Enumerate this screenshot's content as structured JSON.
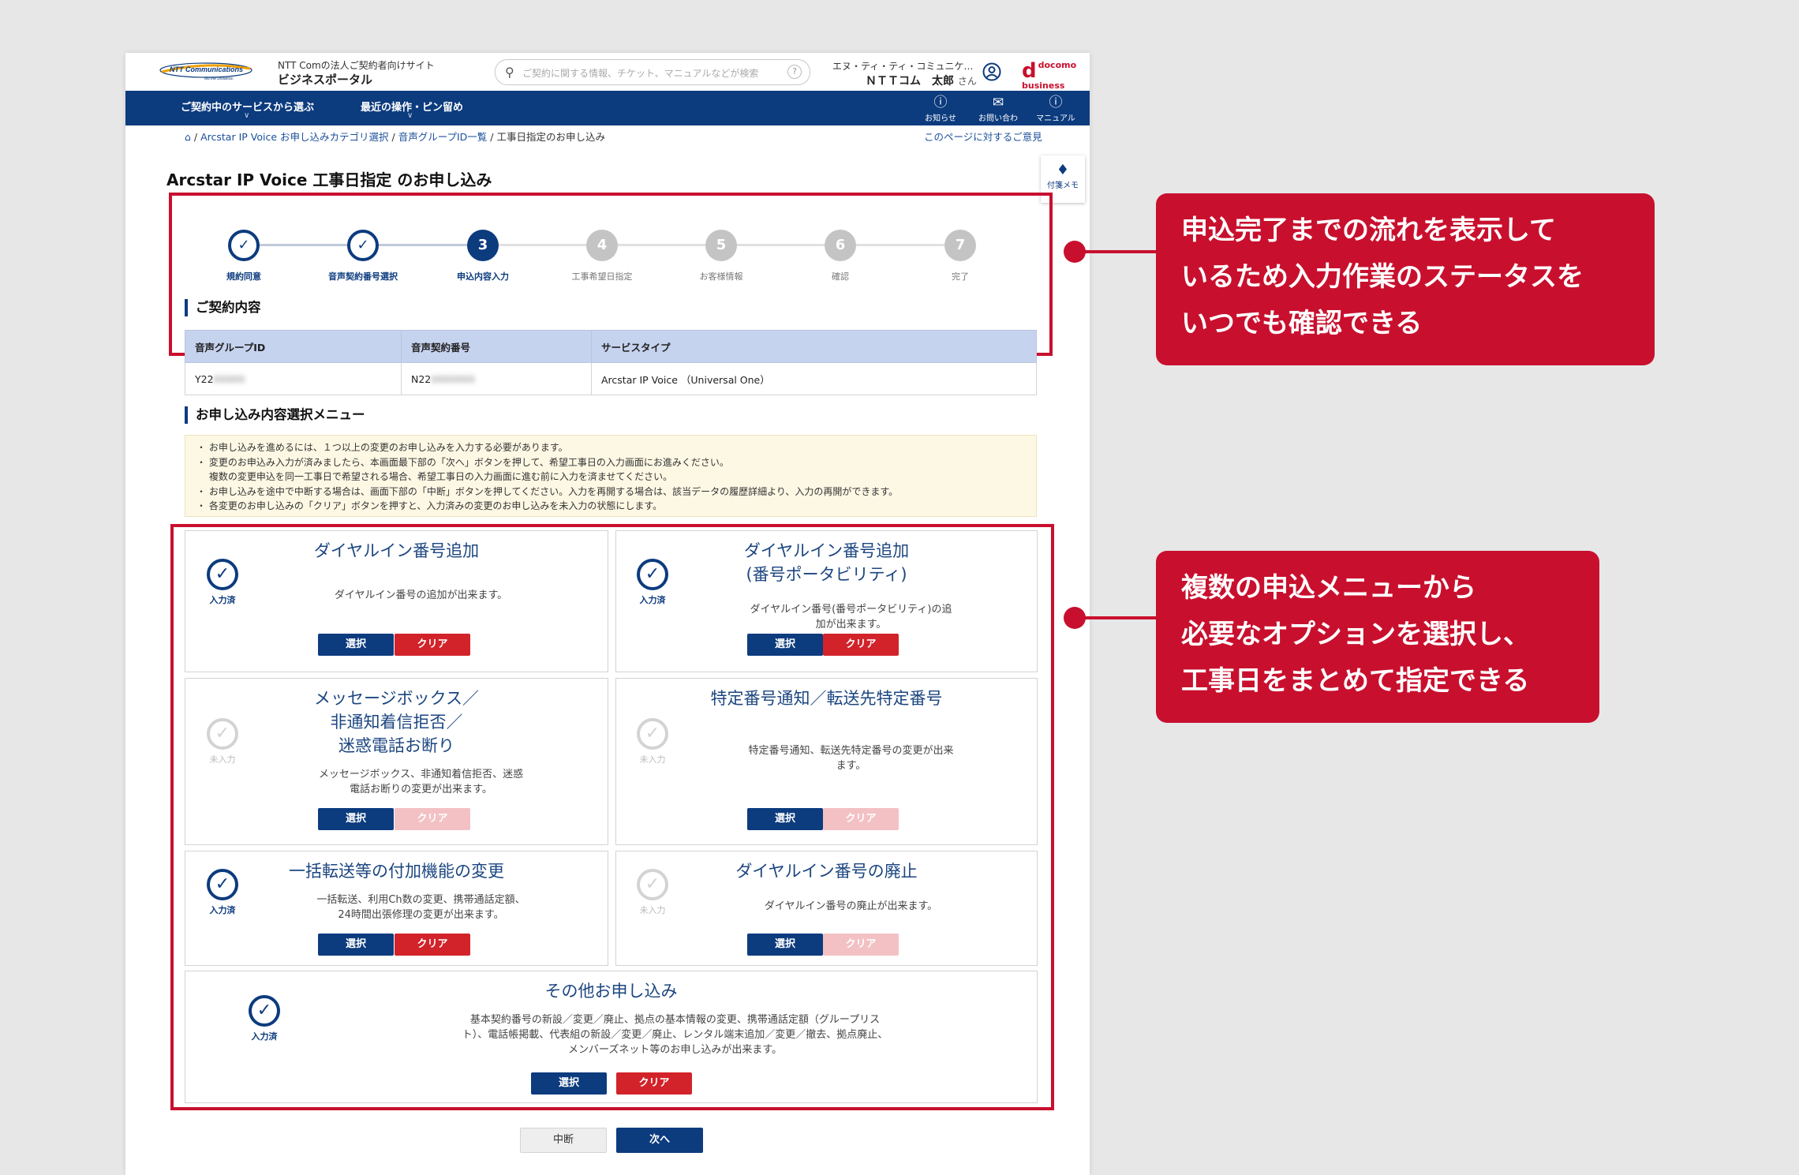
{
  "header": {
    "logo_main": "NTT Communications",
    "logo_tag": "Go the Distance.",
    "site_sub": "NTT Comの法人ご契約者向けサイト",
    "site_title": "ビジネスポータル",
    "search_placeholder": "ご契約に関する情報、チケット、マニュアルなどが検索",
    "company": "エヌ・ティ・ティ・コミュニケ…",
    "user_name": "ＮＴＴコム　太郎",
    "user_suffix": "さん",
    "docomo_line1": "docomo",
    "docomo_line2": "business"
  },
  "nav": {
    "services": "ご契約中のサービスから選ぶ",
    "recent": "最近の操作・ピン留め",
    "notice": "お知らせ",
    "contact": "お問い合わせ",
    "manual": "マニュアル"
  },
  "breadcrumb": {
    "items": [
      "Arcstar IP Voice お申し込みカテゴリ選択",
      "音声グループID一覧",
      "工事日指定のお申し込み"
    ],
    "separator": " / ",
    "feedback": "このページに対するご意見"
  },
  "page_title": "Arcstar IP Voice 工事日指定 のお申し込み",
  "memo_label": "付箋メモ",
  "steps": [
    {
      "num": "✓",
      "label": "規約同意",
      "state": "done"
    },
    {
      "num": "✓",
      "label": "音声契約番号選択",
      "state": "done"
    },
    {
      "num": "3",
      "label": "申込内容入力",
      "state": "current"
    },
    {
      "num": "4",
      "label": "工事希望日指定",
      "state": "todo"
    },
    {
      "num": "5",
      "label": "お客様情報",
      "state": "todo"
    },
    {
      "num": "6",
      "label": "確認",
      "state": "todo"
    },
    {
      "num": "7",
      "label": "完了",
      "state": "todo"
    }
  ],
  "contract": {
    "heading": "ご契約内容",
    "headers": [
      "音声グループID",
      "音声契約番号",
      "サービスタイプ"
    ],
    "values": [
      "Y22",
      "N22",
      "Arcstar IP Voice （Universal One）"
    ],
    "hidden": [
      "00000",
      "0000000"
    ]
  },
  "menu": {
    "heading": "お申し込み内容選択メニュー",
    "notices": [
      "・ お申し込みを進めるには、１つ以上の変更のお申し込みを入力する必要があります。",
      "・ 変更のお申込み入力が済みましたら、本画面最下部の「次へ」ボタンを押して、希望工事日の入力画面にお進みください。",
      "　 複数の変更申込を同一工事日で希望される場合、希望工事日の入力画面に進む前に入力を済ませてください。",
      "・ お申し込みを途中で中断する場合は、画面下部の「中断」ボタンを押してください。入力を再開する場合は、該当データの履歴詳細より、入力の再開ができます。",
      "・ 各変更のお申し込みの「クリア」ボタンを押すと、入力済みの変更のお申し込みを未入力の状態にします。"
    ],
    "cards": [
      {
        "title": [
          "ダイヤルイン番号追加"
        ],
        "desc": [
          "ダイヤルイン番号の追加が出来ます。"
        ],
        "status": "入力済",
        "done": true
      },
      {
        "title": [
          "ダイヤルイン番号追加",
          "(番号ポータビリティ)"
        ],
        "desc": [
          "ダイヤルイン番号(番号ポータビリティ)の追",
          "加が出来ます。"
        ],
        "status": "入力済",
        "done": true
      },
      {
        "title": [
          "メッセージボックス／",
          "非通知着信拒否／",
          "迷惑電話お断り"
        ],
        "desc": [
          "メッセージボックス、非通知着信拒否、迷惑",
          "電話お断りの変更が出来ます。"
        ],
        "status": "未入力",
        "done": false
      },
      {
        "title": [
          "特定番号通知／転送先特定番号"
        ],
        "desc": [
          "特定番号通知、転送先特定番号の変更が出来",
          "ます。"
        ],
        "status": "未入力",
        "done": false
      },
      {
        "title": [
          "一括転送等の付加機能の変更"
        ],
        "desc": [
          "一括転送、利用Ch数の変更、携帯通話定額、",
          "24時間出張修理の変更が出来ます。"
        ],
        "status": "入力済",
        "done": true
      },
      {
        "title": [
          "ダイヤルイン番号の廃止"
        ],
        "desc": [
          "ダイヤルイン番号の廃止が出来ます。"
        ],
        "status": "未入力",
        "done": false
      },
      {
        "title": [
          "その他お申し込み"
        ],
        "desc": [
          "基本契約番号の新設／変更／廃止、拠点の基本情報の変更、携帯通話定額（グループリス",
          "ト）、電話帳掲載、代表組の新設／変更／廃止、レンタル端末追加／変更／撤去、拠点廃止、",
          "メンバーズネット等のお申し込みが出来ます。"
        ],
        "status": "入力済",
        "done": true
      }
    ],
    "select_label": "選択",
    "clear_label": "クリア"
  },
  "footer_buttons": {
    "suspend": "中断",
    "next": "次へ"
  },
  "callouts": [
    {
      "lines": [
        "申込完了までの流れを表示して",
        "いるため入力作業のステータスを",
        "いつでも確認できる"
      ]
    },
    {
      "lines": [
        "複数の申込メニューから",
        "必要なオプションを選択し、",
        "工事日をまとめて指定できる"
      ]
    }
  ],
  "colors": {
    "navy": "#0c3b7e",
    "accent_red": "#c8102e",
    "clear_red": "#d2232a",
    "table_header": "#c6d3ef",
    "notice_bg": "#fdf8e4"
  }
}
